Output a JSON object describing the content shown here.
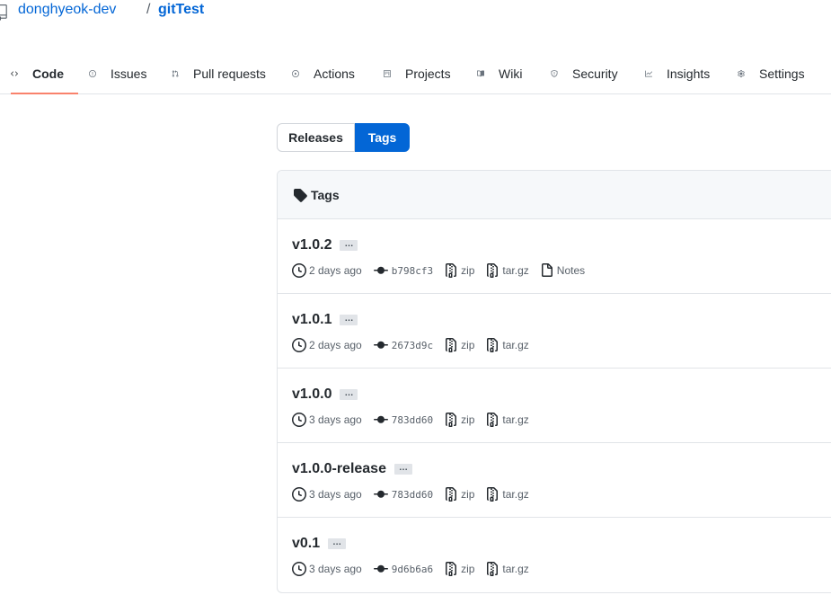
{
  "repo": {
    "owner": "donghyeok-dev",
    "separator": "/",
    "name": "gitTest"
  },
  "tabs": [
    {
      "label": "Code",
      "icon": "code-icon",
      "selected": true
    },
    {
      "label": "Issues",
      "icon": "issue-opened-icon"
    },
    {
      "label": "Pull requests",
      "icon": "git-pull-request-icon"
    },
    {
      "label": "Actions",
      "icon": "play-icon"
    },
    {
      "label": "Projects",
      "icon": "project-icon"
    },
    {
      "label": "Wiki",
      "icon": "book-icon"
    },
    {
      "label": "Security",
      "icon": "shield-icon"
    },
    {
      "label": "Insights",
      "icon": "graph-icon"
    },
    {
      "label": "Settings",
      "icon": "gear-icon"
    }
  ],
  "toggle": {
    "releases": "Releases",
    "tags": "Tags",
    "selected": "Tags"
  },
  "tags_box": {
    "heading": "Tags"
  },
  "tags": [
    {
      "name": "v1.0.2",
      "ellipsis": "…",
      "time": "2 days ago",
      "sha": "b798cf3",
      "zip": "zip",
      "targz": "tar.gz",
      "notes": "Notes"
    },
    {
      "name": "v1.0.1",
      "ellipsis": "…",
      "time": "2 days ago",
      "sha": "2673d9c",
      "zip": "zip",
      "targz": "tar.gz"
    },
    {
      "name": "v1.0.0",
      "ellipsis": "…",
      "time": "3 days ago",
      "sha": "783dd60",
      "zip": "zip",
      "targz": "tar.gz"
    },
    {
      "name": "v1.0.0-release",
      "ellipsis": "…",
      "time": "3 days ago",
      "sha": "783dd60",
      "zip": "zip",
      "targz": "tar.gz"
    },
    {
      "name": "v0.1",
      "ellipsis": "…",
      "time": "3 days ago",
      "sha": "9d6b6a6",
      "zip": "zip",
      "targz": "tar.gz"
    }
  ],
  "colors": {
    "link": "#0366d6",
    "selected_tab_underline": "#f9826c",
    "primary_button": "#0366d6"
  }
}
